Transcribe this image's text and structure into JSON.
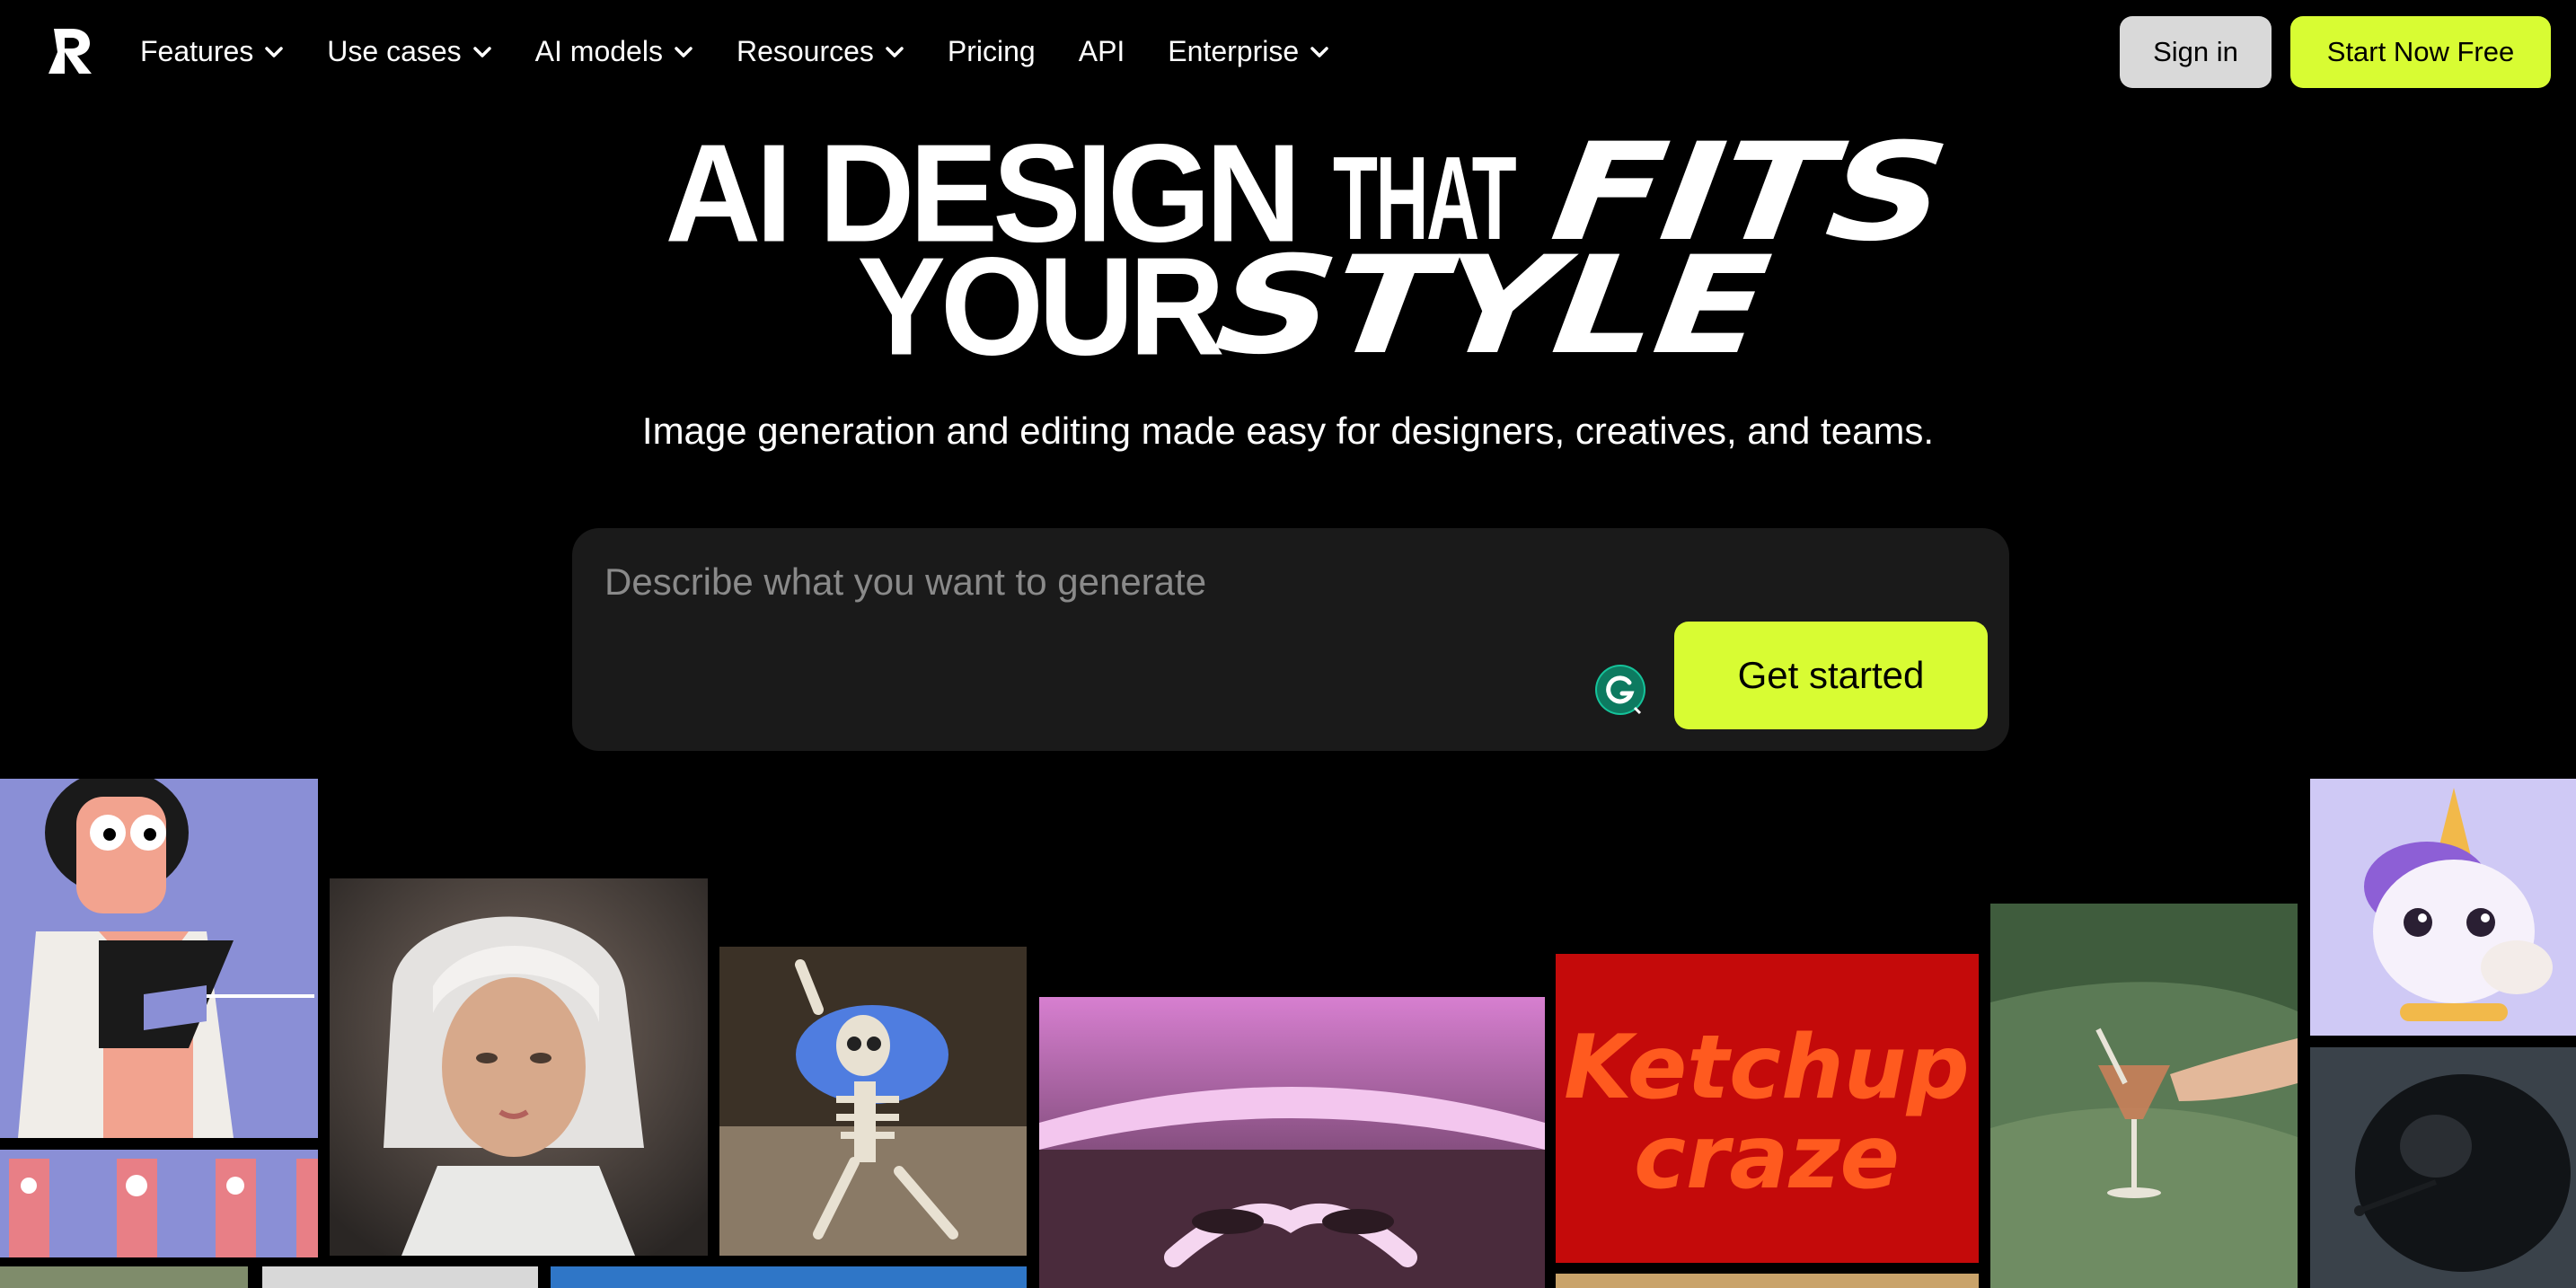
{
  "nav": {
    "items": [
      {
        "label": "Features",
        "dropdown": true
      },
      {
        "label": "Use cases",
        "dropdown": true
      },
      {
        "label": "AI models",
        "dropdown": true
      },
      {
        "label": "Resources",
        "dropdown": true
      },
      {
        "label": "Pricing",
        "dropdown": false
      },
      {
        "label": "API",
        "dropdown": false
      },
      {
        "label": "Enterprise",
        "dropdown": true
      }
    ],
    "sign_in": "Sign in",
    "start": "Start Now Free"
  },
  "hero": {
    "line1_a": "AI DESIGN",
    "line1_b": "THAT",
    "line1_c": "FITS",
    "line2_a": "YOUR",
    "line2_b": "STYLE",
    "subtitle": "Image generation and editing made easy for designers, creatives, and teams."
  },
  "prompt": {
    "placeholder": "Describe what you want to generate",
    "value": "",
    "button": "Get started"
  },
  "gallery": {
    "ketchup_text_1": "Ketchup",
    "ketchup_text_2": "craze"
  },
  "colors": {
    "accent": "#d8fc33",
    "background": "#000000",
    "prompt_bg": "#1a1a1a",
    "sign_in_bg": "#d9d9d9"
  }
}
